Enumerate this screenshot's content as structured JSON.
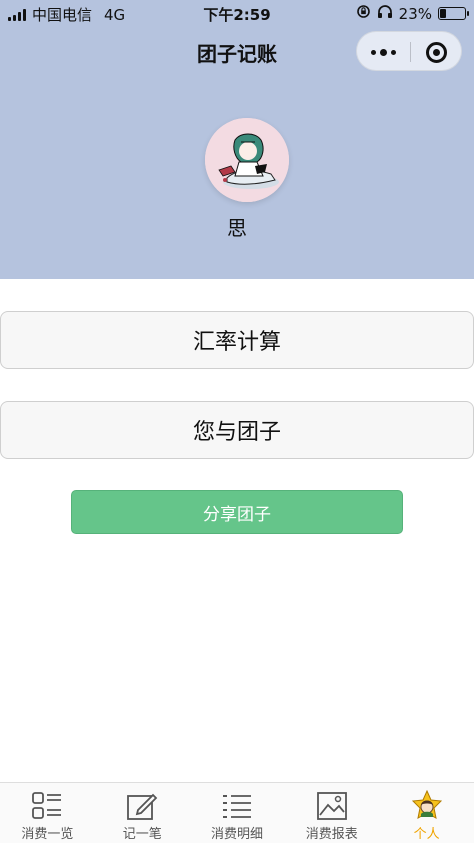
{
  "status_bar": {
    "carrier": "中国电信",
    "network": "4G",
    "time": "下午2:59",
    "battery": "23%",
    "battery_level": 0.23
  },
  "nav": {
    "title": "团子记账"
  },
  "profile": {
    "name": "思"
  },
  "menu": {
    "items": [
      {
        "label": "汇率计算"
      },
      {
        "label": "您与团子"
      }
    ],
    "share_label": "分享团子"
  },
  "tabbar": {
    "items": [
      {
        "label": "消费一览",
        "icon": "grid-list-icon"
      },
      {
        "label": "记一笔",
        "icon": "edit-icon"
      },
      {
        "label": "消费明细",
        "icon": "list-icon"
      },
      {
        "label": "消费报表",
        "icon": "image-chart-icon"
      },
      {
        "label": "个人",
        "icon": "person-star-icon"
      }
    ],
    "active": "个人"
  },
  "colors": {
    "header_bg": "#b5c3de",
    "share_button": "#65c58a",
    "active_tab": "#f0a400"
  }
}
